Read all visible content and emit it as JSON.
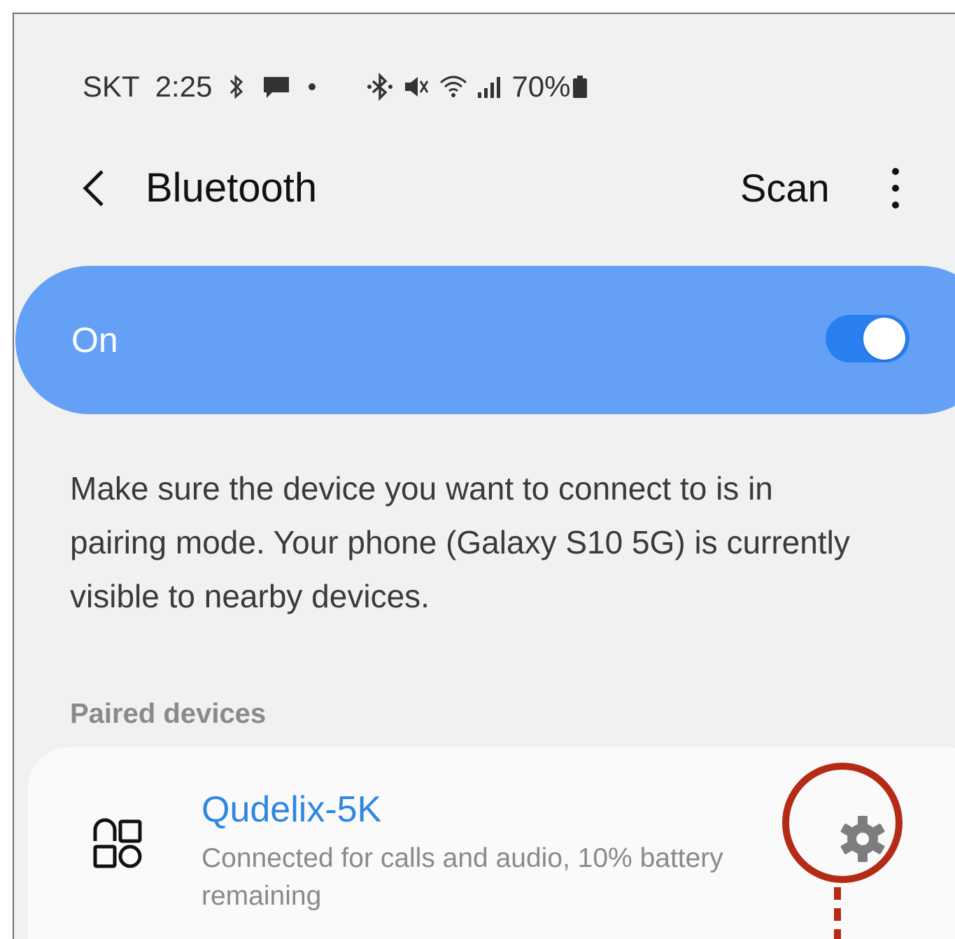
{
  "status_bar": {
    "carrier": "SKT",
    "time": "2:25",
    "battery": "70%",
    "icons": [
      "bluetooth-icon",
      "message-icon",
      "dot-icon",
      "bluetooth-icon",
      "mute-icon",
      "wifi-icon",
      "signal-icon",
      "battery-icon"
    ]
  },
  "app_bar": {
    "title": "Bluetooth",
    "scan_label": "Scan"
  },
  "bluetooth_toggle": {
    "label": "On",
    "enabled": true,
    "accent_color": "#64a1f6"
  },
  "description": "Make sure the device you want to connect to is in pairing mode. Your phone (Galaxy S10 5G) is currently visible to nearby devices.",
  "paired_devices": {
    "header": "Paired devices",
    "items": [
      {
        "name": "Qudelix-5K",
        "status": "Connected for calls and audio, 10% battery remaining",
        "icon": "device-generic-icon"
      }
    ]
  },
  "annotation": {
    "color": "#b52a15",
    "target": "settings-gear-icon"
  }
}
